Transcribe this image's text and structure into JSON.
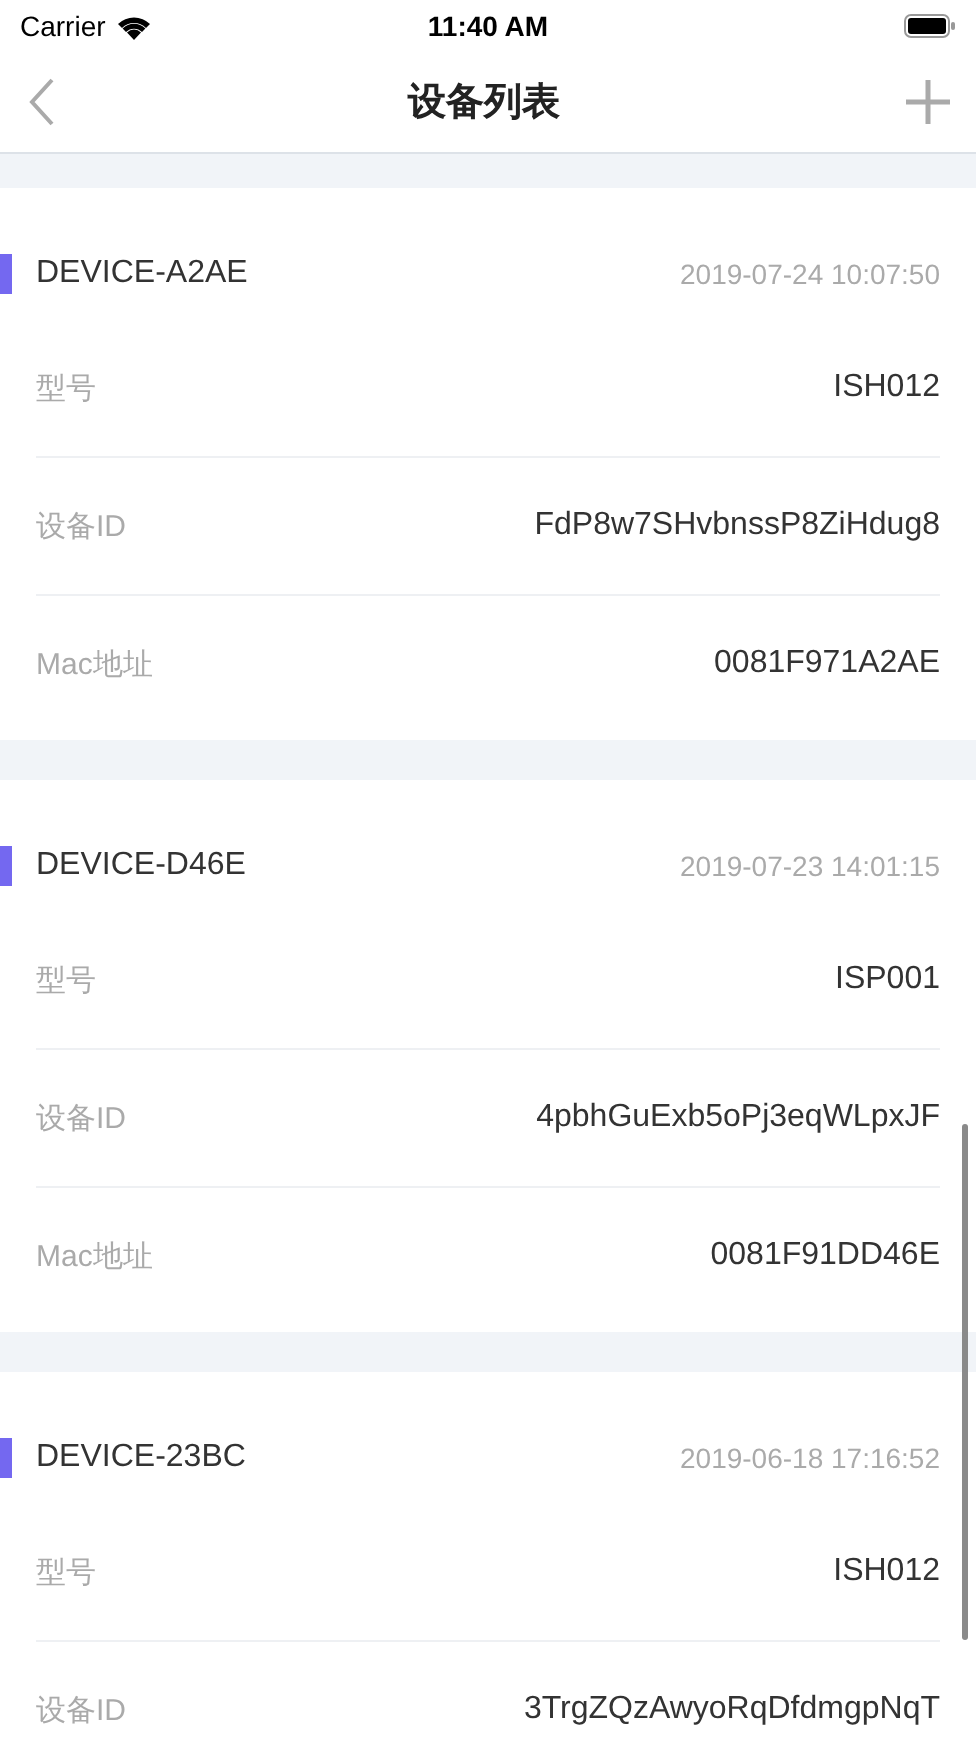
{
  "status_bar": {
    "carrier": "Carrier",
    "time": "11:40 AM"
  },
  "nav": {
    "title": "设备列表"
  },
  "devices": [
    {
      "name": "DEVICE-A2AE",
      "time": "2019-07-24 10:07:50",
      "color": "#7468f0",
      "fields": [
        {
          "label": "型号",
          "value": "ISH012"
        },
        {
          "label": "设备ID",
          "value": "FdP8w7SHvbnssP8ZiHdug8"
        },
        {
          "label": "Mac地址",
          "value": "0081F971A2AE"
        }
      ]
    },
    {
      "name": "DEVICE-D46E",
      "time": "2019-07-23 14:01:15",
      "color": "#7468f0",
      "fields": [
        {
          "label": "型号",
          "value": "ISP001"
        },
        {
          "label": "设备ID",
          "value": "4pbhGuExb5oPj3eqWLpxJF"
        },
        {
          "label": "Mac地址",
          "value": "0081F91DD46E"
        }
      ]
    },
    {
      "name": "DEVICE-23BC",
      "time": "2019-06-18 17:16:52",
      "color": "#7468f0",
      "fields": [
        {
          "label": "型号",
          "value": "ISH012"
        },
        {
          "label": "设备ID",
          "value": "3TrgZQzAwyoRqDfdmgpNqT"
        }
      ]
    }
  ]
}
